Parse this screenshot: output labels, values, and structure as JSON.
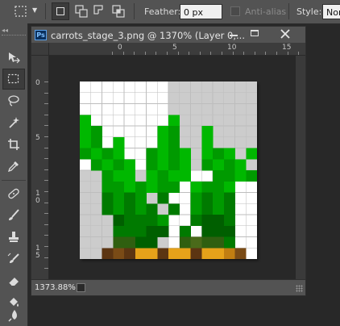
{
  "options_bar": {
    "feather_label": "Feather:",
    "feather_value": "0 px",
    "antialias_label": "Anti-alias",
    "style_label": "Style:",
    "style_value": "Nor"
  },
  "document": {
    "title": "carrots_stage_3.png @ 1370% (Layer 0,...",
    "ps_badge": "Ps",
    "zoom": "1373.88%",
    "ruler_h": [
      "0",
      "5",
      "10",
      "15"
    ],
    "ruler_v": [
      [
        "0"
      ],
      [
        "5"
      ],
      [
        "1",
        "0"
      ],
      [
        "1",
        "5"
      ]
    ]
  },
  "colors": {
    "checker_light": "#ffffff",
    "checker_dark": "#cccccc",
    "g1": "#00b800",
    "g2": "#009a00",
    "g3": "#007a00",
    "g4": "#005f00",
    "g5": "#2f5f10",
    "g6": "#4a6a1a",
    "c1": "#e6a21a",
    "c2": "#c17e12",
    "c3": "#5c3512",
    "c4": "#7a4b16",
    "c5": "#2f7a10"
  },
  "pixel_rows": [
    "................",
    "................",
    "................",
    "................",
    "................",
    "1.......1.......",
    "12.....12..1....",
    "12.1...12..1....",
    "2121..2121.121.1",
    ".2121.2121.2121.",
    "..211.1211..2212",
    "..2212122.1221..",
    "..3232.3..2323..",
    "..32323.3.2323..",
    "...43332..3443..",
    "...33344.3.444..",
    "...5544..56553..",
    "..cdcaacaacaabd.",
    "................"
  ]
}
